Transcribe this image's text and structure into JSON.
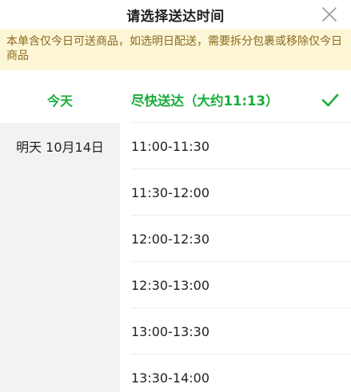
{
  "header": {
    "title": "请选择送达时间",
    "close_icon": "close-icon"
  },
  "notice": {
    "text": "本单含仅今日可送商品，如选明日配送，需要拆分包裹或移除仅今日商品"
  },
  "days": [
    {
      "label": "今天",
      "active": true
    },
    {
      "label": "明天 10月14日",
      "active": false
    }
  ],
  "slots": [
    {
      "label": "尽快送达（大约11:13）",
      "selected": true
    },
    {
      "label": "11:00-11:30",
      "selected": false
    },
    {
      "label": "11:30-12:00",
      "selected": false
    },
    {
      "label": "12:00-12:30",
      "selected": false
    },
    {
      "label": "12:30-13:00",
      "selected": false
    },
    {
      "label": "13:00-13:30",
      "selected": false
    },
    {
      "label": "13:30-14:00",
      "selected": false
    }
  ],
  "colors": {
    "accent": "#1aad3a",
    "notice_bg": "#fdf6d6",
    "notice_text": "#8a6a1e",
    "day_inactive_bg": "#f2f2f2"
  },
  "icons": {
    "selected_mark": "check-icon"
  }
}
